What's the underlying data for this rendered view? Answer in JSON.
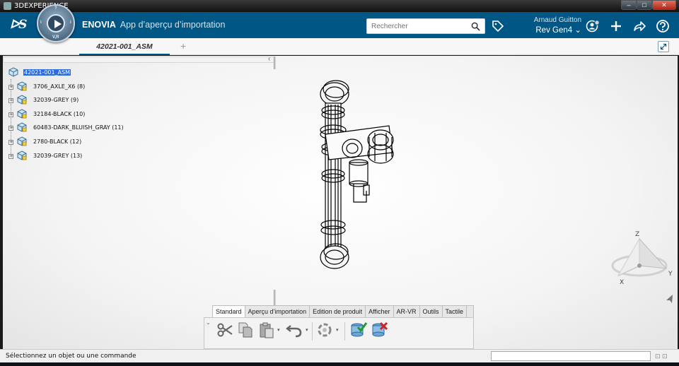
{
  "window": {
    "title": "3DEXPERIENCE",
    "buttons": {
      "minimize": "–",
      "maximize": "□",
      "close": "✕"
    }
  },
  "topbar": {
    "brand": "ENOVIA",
    "app_name": "App d’aperçu d’importation",
    "compass_quadrants": {
      "top": "?",
      "left": "i",
      "right": "i",
      "bottom": "V,R"
    },
    "search": {
      "placeholder": "Rechercher",
      "value": ""
    },
    "user": {
      "name": "Arnaud Guitton",
      "context": "Rev Gen4"
    },
    "icons": [
      "tag-icon",
      "user-settings-icon",
      "add-icon",
      "share-icon",
      "help-icon"
    ],
    "colors": {
      "bar": "#005685",
      "accent": "#2d6cdf"
    }
  },
  "tabs": {
    "active": "42021-001_ASM",
    "add": "+"
  },
  "tree": {
    "collapse": "‹",
    "root": "42021-001_ASM",
    "children": [
      "3706_AXLE_X6 (8)",
      "32039-GREY (9)",
      "32184-BLACK (10)",
      "60483-DARK_BLUISH_GRAY (11)",
      "2780-BLACK (12)",
      "32039-GREY (13)"
    ]
  },
  "triad": {
    "z": "Z",
    "x": "X",
    "y": "Y"
  },
  "action_bar": {
    "tabs": [
      "Standard",
      "Aperçu d’importation",
      "Edition de produit",
      "Afficher",
      "AR-VR",
      "Outils",
      "Tactile"
    ],
    "active_tab": "Standard",
    "collapse": "⌄",
    "tools": [
      "cut-icon",
      "copy-icon",
      "paste-icon",
      "undo-icon",
      "update-icon",
      "sync-database-icon",
      "delete-database-icon"
    ]
  },
  "status": {
    "message": "Sélectionnez un objet ou une commande",
    "command_value": "",
    "icons": "⊡ ⊡"
  }
}
